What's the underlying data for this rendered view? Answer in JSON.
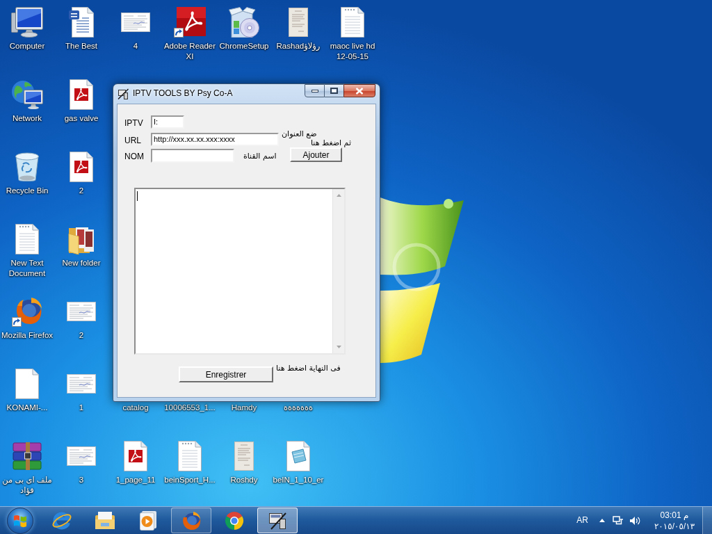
{
  "desktop": {
    "rows": [
      [
        {
          "label": "Computer",
          "kind": "computer"
        },
        {
          "label": "The Best",
          "kind": "word"
        },
        {
          "label": "4",
          "kind": "scan"
        },
        {
          "label": "Adobe Reader XI",
          "kind": "pdf_shortcut"
        },
        {
          "label": "ChromeSetup",
          "kind": "setup"
        },
        {
          "label": "Rashadرؤلاؤ",
          "kind": "paper"
        },
        {
          "label": "maoc live hd 12-05-15",
          "kind": "text"
        }
      ],
      [
        {
          "label": "Network",
          "kind": "network"
        },
        {
          "label": "gas valve",
          "kind": "pdf"
        }
      ],
      [
        {
          "label": "Recycle Bin",
          "kind": "recycle"
        },
        {
          "label": "2",
          "kind": "pdf"
        }
      ],
      [
        {
          "label": "New Text Document",
          "kind": "text"
        },
        {
          "label": "New folder",
          "kind": "folder"
        }
      ],
      [
        {
          "label": "Mozilla Firefox",
          "kind": "firefox_shortcut"
        },
        {
          "label": "2",
          "kind": "scan"
        }
      ],
      [
        {
          "label": "KONAMI-...",
          "kind": "blank"
        },
        {
          "label": "1",
          "kind": "scan"
        },
        {
          "label": "catalog"
        },
        {
          "label": "10006553_1..."
        },
        {
          "label": "Hamdy"
        },
        {
          "label": "ةةةةةةة"
        }
      ],
      [
        {
          "label": "ملف اى بى من فؤاد",
          "kind": "archive"
        },
        {
          "label": "3",
          "kind": "scan"
        },
        {
          "label": "1_page_11",
          "kind": "pdf"
        },
        {
          "label": "beinSport_H...",
          "kind": "text"
        },
        {
          "label": "Roshdy",
          "kind": "paper"
        },
        {
          "label": "beIN_1_10_er",
          "kind": "notepad"
        }
      ]
    ]
  },
  "window": {
    "title": "IPTV TOOLS BY Psy Co-A",
    "fields": [
      {
        "label": "IPTV",
        "value": "I:"
      },
      {
        "label": "URL",
        "value": "http://xxx.xx.xx.xxx:xxxx"
      },
      {
        "label": "NOM"
      }
    ],
    "url_hint": "ضع العنوان",
    "add_hint": "ثم اضغط هنا",
    "add_button": "Ajouter",
    "name_hint": "اسم القناة",
    "editor": {
      "focused": true
    },
    "save_button": "Enregistrer",
    "save_hint": "فى النهاية اضغط هنا"
  },
  "taskbar": {
    "items": [
      {
        "kind": "start"
      },
      {
        "kind": "ie",
        "running": false,
        "selected": false
      },
      {
        "kind": "explorer",
        "running": false,
        "selected": false
      },
      {
        "kind": "media",
        "running": false,
        "selected": false
      },
      {
        "kind": "firefox",
        "running": true,
        "selected": false
      },
      {
        "kind": "chrome",
        "running": false,
        "selected": false
      },
      {
        "kind": "app",
        "running": true,
        "selected": true
      }
    ],
    "tray": {
      "language": "AR",
      "time": "03:01 م",
      "date": "٢٠١٥/٠٥/١٣"
    }
  }
}
